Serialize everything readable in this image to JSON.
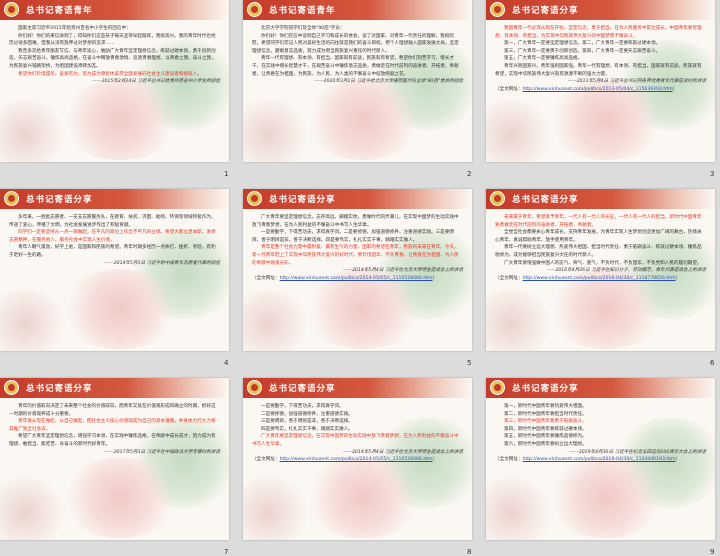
{
  "slides": [
    {
      "title": "总书记寄语青年",
      "page": "1",
      "paragraphs": [
        {
          "text": "国家主席习近平2015年给贵州百名中小学生的回信中：",
          "kind": "plain"
        },
        {
          "text": "你们好！你们的来信收到了，得知你们这些孩子每天坚持早起锻炼，我很高兴。我的青年时代也经历过很多困难，但我从没有放弃过对梦想的追求……",
          "kind": "plain"
        },
        {
          "text": "我曾多次给青年朋友写信、与青年谈心，勉励广大青年坚定理想信念，练就过硬本领，勇于创新创造，矢志艰苦奋斗，锤炼高尚品格，在奋斗中释放青春激情、追逐青春理想，以青春之我、奋斗之我，为民族复兴铺路架桥，为祖国建设添砖加瓦。",
          "kind": "plain"
        },
        {
          "text": "希望你们珍惜韶华，奋发有为，努力成为德智体美劳全面发展的社会主义建设者和接班人。",
          "kind": "red"
        },
        {
          "text": "——2015年2月24日 习近平总书记给贵州百名中小学生的回信",
          "kind": "sig"
        }
      ]
    },
    {
      "title": "总书记寄语青年",
      "page": "2",
      "paragraphs": [
        {
          "text": "北京大学学院同学们及全体\"90后\"学员：",
          "kind": "plain"
        },
        {
          "text": "你们好！你们在信中谈到自己学习和成长的体会，谈了对国家、对青年一代责任的理解，我很欣慰。希望同学们牢记人民对美好生活的向往就是我们的奋斗目标，把个人理想融入国家发展大局，坚定理想信念，磨砺意志品质，努力成为堪当民族复兴重任的时代新人。",
          "kind": "plain"
        },
        {
          "text": "青年一代有理想、有本领、有担当，国家就有前途，民族就有希望。希望你们刻苦学习，增长才干，在实践中增长智慧才干，在艰苦奋斗中锤炼意志品质，勇做走在时代前列的奋进者、开拓者、奉献者，让青春在为祖国、为民族、为人民、为人类的不懈奋斗中绽放绚丽之花。",
          "kind": "plain"
        },
        {
          "text": "——2020年3月2日 习近平给北京大学援鄂医疗队全体\"90后\"党员的回信",
          "kind": "sig"
        }
      ]
    },
    {
      "title": "总书记寄语分享",
      "page": "3",
      "paragraphs": [
        {
          "text": "我国青年一代必须从现在开始，坚定信念，勇于担当，在为人民服务中茁壮成长。中国青年要有理想、有本领、有担当，为实现中华民族伟大复兴的中国梦而不懈奋斗。",
          "kind": "red"
        },
        {
          "text": "第一，广大青年一定要坚定理想信念。第二，广大青年一定要练就过硬本领。",
          "kind": "plain"
        },
        {
          "text": "第三，广大青年一定要勇于创新创造。第四，广大青年一定要矢志艰苦奋斗。",
          "kind": "plain"
        },
        {
          "text": "第五，广大青年一定要锤炼高尚品格。",
          "kind": "plain"
        },
        {
          "text": "青年兴则国家兴，青年强则国家强。青年一代有理想、有本领、有担当，国家就有前途，民族就有希望，实现中华民族伟大复兴就有源源不断的强大力量。",
          "kind": "plain"
        },
        {
          "text": "——2013年5月4日 习近平总书记同各界优秀青年代表座谈时的讲话",
          "kind": "sig"
        },
        {
          "text": "（全文网址：",
          "link": "http://www.xinhuanet.com/politics/2013-05/04/c_115639203.htm",
          "tail": "）",
          "kind": "src"
        }
      ]
    },
    {
      "title": "总书记寄语分享",
      "page": "4",
      "paragraphs": [
        {
          "text": "多年来，一批批志愿者、一支支志愿服务队，在教育、扶贫、济困、助残、环保等领域积极作为，传递了爱心，传播了文明，为社会发展进步作出了积极贡献。",
          "kind": "plain"
        },
        {
          "text": "同学们一定要坚持从一点一滴做起，在平凡的岗位上作出不平凡的业绩。希望大家立足本职，发扬志愿精神，在服务他人、服务社会中实现人生价值。",
          "kind": "red"
        },
        {
          "text": "青年人朝气蓬勃，好学上进，是国家和民族的希望。青年时期多经历一点摔打、挫折、考验，有利于走好一生的路。",
          "kind": "plain"
        },
        {
          "text": "——2014年5月3日 习近平给中国青年志愿者代表的回信",
          "kind": "sig"
        }
      ]
    },
    {
      "title": "总书记寄语分享",
      "page": "5",
      "paragraphs": [
        {
          "text": "广大青年要坚定理想信念，志存高远，脚踏实地，勇做时代的弄潮儿，在实现中国梦的生动实践中放飞青春梦想，在为人民利益的不懈奋斗中书写人生华章。",
          "kind": "plain"
        },
        {
          "text": "一是要勤学，下得苦功夫，求得真学问。二是要修德，加强道德修养，注重道德实践。三是要明辨，善于明辨是非，善于决断选择。四是要笃实，扎扎实实干事，踏踏实实做人。",
          "kind": "plain"
        },
        {
          "text": "青年是整个社会力量中最积极、最有生气的力量，国家的希望在青年，民族的未来在青年。今天，新一代青年赶上了实现中华民族伟大复兴的好时代，要珍惜韶华、不负青春，让青春在为祖国、为人民的奉献中焕发光彩。",
          "kind": "red"
        },
        {
          "text": "——2014年5月4日 习近平在北京大学师生座谈会上的讲话",
          "kind": "sig"
        },
        {
          "text": "（全文网址：",
          "link": "http://www.xinhuanet.com/politics/2014-05/05/c_1110528066.htm",
          "tail": "）",
          "kind": "src"
        }
      ]
    },
    {
      "title": "总书记寄语分享",
      "page": "6",
      "paragraphs": [
        {
          "text": "未来属于青年，希望寄予青年。一代人有一代人的长征，一代人有一代人的担当。新时代中国青年要勇做走在时代前列的奋进者、开拓者、奉献者。",
          "kind": "red"
        },
        {
          "text": "全党全社会都要关心青年成长，支持青年发展，为青年实现人生梦想创造更加广阔的舞台，热情关心青年、真诚帮助青年、放手使用青年。",
          "kind": "plain"
        },
        {
          "text": "青年一代要树立远大理想、热爱伟大祖国、担当时代责任、勇于砥砺奋斗、练就过硬本领、锤炼品德修为，成为能够担当民族复兴大任的时代新人。",
          "kind": "plain"
        },
        {
          "text": "广大青年要增强做中国人的志气、骨气、底气，不负时代，不负韶华，不负党和人民的殷切期望。",
          "kind": "plain"
        },
        {
          "text": "——2016年4月26日 习近平在知识分子、劳动模范、青年代表座谈会上的讲话",
          "kind": "sig"
        },
        {
          "text": "（全文网址：",
          "link": "http://www.xinhuanet.com/politics/2016-04/30/c_1118778656.htm",
          "tail": "）",
          "kind": "src"
        }
      ]
    },
    {
      "title": "总书记寄语分享",
      "page": "7",
      "paragraphs": [
        {
          "text": "青年的价值取向决定了未来整个社会的价值取向，而青年又处在价值观形成和确立的时期，抓好这一时期的价值观养成十分重要。",
          "kind": "plain"
        },
        {
          "text": "青年要从现在做起、从自己做起，使社会主义核心价值观成为自己的基本遵循，并身体力行大力将其推广到全社会去。",
          "kind": "red"
        },
        {
          "text": "希望广大青年坚定理想信念，增强学习本领，在实践中锤炼品格，在奉献中成长成才，努力成为有理想、敢担当、能吃苦、肯奋斗的新时代好青年。",
          "kind": "plain"
        },
        {
          "text": "——2017年5月3日 习近平在中国政法大学考察时的讲话",
          "kind": "sig"
        }
      ]
    },
    {
      "title": "总书记寄语分享",
      "page": "8",
      "paragraphs": [
        {
          "text": "一是要勤学，下得苦功夫，求得真学问。",
          "kind": "plain"
        },
        {
          "text": "二是要修德，加强道德修养，注重道德实践。",
          "kind": "plain"
        },
        {
          "text": "三是要明辨，善于明辨是非，善于决断选择。",
          "kind": "plain"
        },
        {
          "text": "四是要笃实，扎扎实实干事，踏踏实实做人。",
          "kind": "plain"
        },
        {
          "text": "广大青年要坚定理想信念，在实现中国梦的生动实践中放飞青春梦想，在为人民利益的不懈奋斗中书写人生华章。",
          "kind": "red"
        },
        {
          "text": "——2014年5月4日 习近平在北京大学师生座谈会上的讲话",
          "kind": "sig"
        },
        {
          "text": "（全文网址：",
          "link": "http://www.xinhuanet.com/politics/2014-05/05/c_1110528066.htm",
          "tail": "）",
          "kind": "src"
        }
      ]
    },
    {
      "title": "总书记寄语分享",
      "page": "9",
      "paragraphs": [
        {
          "text": "第一，新时代中国青年要热爱伟大祖国。",
          "kind": "plain"
        },
        {
          "text": "第二，新时代中国青年要担当时代责任。",
          "kind": "plain"
        },
        {
          "text": "第三，新时代中国青年要勇于砥砺奋斗。",
          "kind": "red"
        },
        {
          "text": "第四，新时代中国青年要练就过硬本领。",
          "kind": "plain"
        },
        {
          "text": "第五，新时代中国青年要锤炼品德修为。",
          "kind": "plain"
        },
        {
          "text": "第六，新时代中国青年要树立远大理想。",
          "kind": "plain"
        },
        {
          "text": "——2019年4月30日 习近平在纪念五四运动100周年大会上的讲话",
          "kind": "sig"
        },
        {
          "text": "（全文网址：",
          "link": "http://www.xinhuanet.com/politics/2019-04/30/c_1124440193.htm",
          "tail": "）",
          "kind": "src"
        }
      ]
    }
  ]
}
